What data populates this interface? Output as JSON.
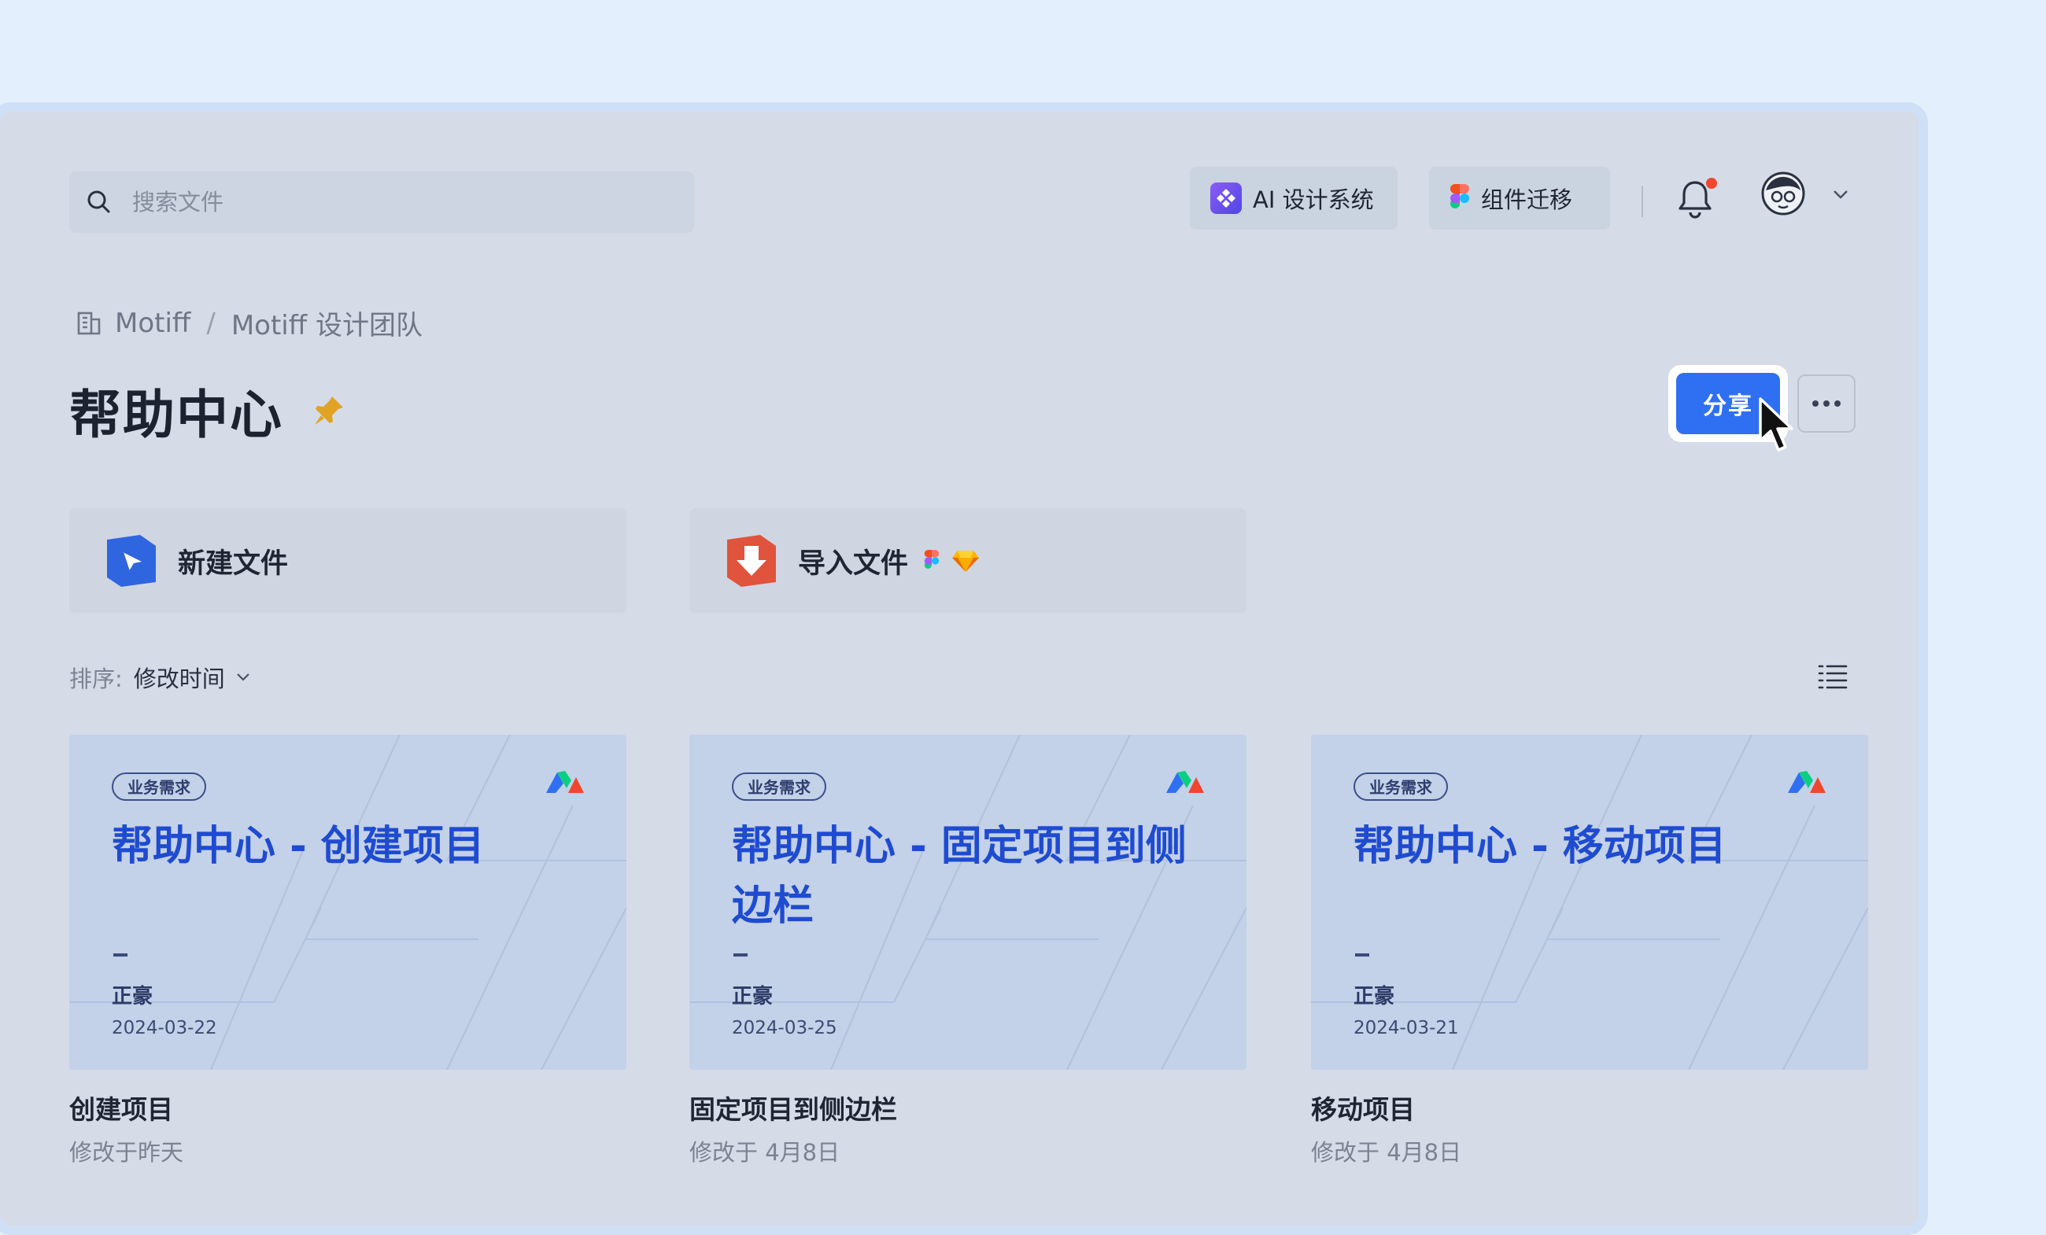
{
  "search": {
    "placeholder": "搜索文件"
  },
  "header": {
    "chips": [
      {
        "label": "AI 设计系统",
        "icon": "ai-design-system-icon"
      },
      {
        "label": "组件迁移",
        "icon": "figma-icon"
      }
    ]
  },
  "breadcrumb": {
    "org": "Motiff",
    "team": "Motiff 设计团队"
  },
  "page": {
    "title": "帮助中心"
  },
  "actions": {
    "share": "分享",
    "new_file": "新建文件",
    "import_file": "导入文件"
  },
  "sort": {
    "label": "排序:",
    "value": "修改时间"
  },
  "files": [
    {
      "tag": "业务需求",
      "thumb_title": "帮助中心 - 创建项目",
      "author": "正豪",
      "date": "2024-03-22",
      "name": "创建项目",
      "modified": "修改于昨天"
    },
    {
      "tag": "业务需求",
      "thumb_title": "帮助中心 - 固定项目到侧边栏",
      "author": "正豪",
      "date": "2024-03-25",
      "name": "固定项目到侧边栏",
      "modified": "修改于 4月8日"
    },
    {
      "tag": "业务需求",
      "thumb_title": "帮助中心 - 移动项目",
      "author": "正豪",
      "date": "2024-03-21",
      "name": "移动项目",
      "modified": "修改于 4月8日"
    }
  ],
  "colors": {
    "accent": "#2f6ff2",
    "thumb_title": "#1f4bd0",
    "background": "#e3effd"
  }
}
